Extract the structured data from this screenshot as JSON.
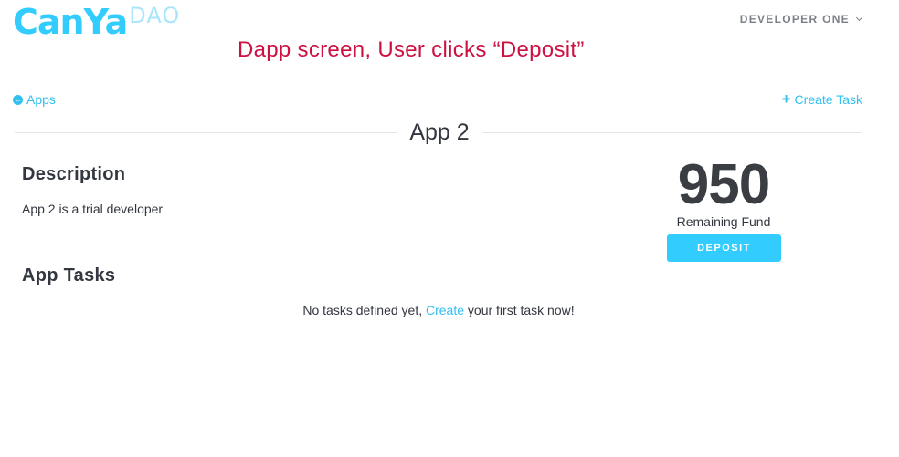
{
  "header": {
    "logo_main": "CanYa",
    "logo_suffix": "DAO",
    "user_name": "DEVELOPER ONE"
  },
  "annotation": "Dapp screen, User clicks “Deposit”",
  "nav": {
    "back_label": "Apps",
    "back_icon": "arrow-circle-left-icon",
    "create_label": "Create Task",
    "create_icon": "plus-icon"
  },
  "page": {
    "title": "App 2"
  },
  "description": {
    "heading": "Description",
    "text": "App 2 is a trial developer"
  },
  "fund": {
    "value": "950",
    "label": "Remaining Fund",
    "deposit_label": "DEPOSIT"
  },
  "tasks": {
    "heading": "App Tasks",
    "empty_before": "No tasks defined yet, ",
    "empty_link": "Create",
    "empty_after": " your first task now!"
  },
  "colors": {
    "accent": "#33ccff",
    "link": "#33c0ef",
    "annotation": "#cc1141",
    "text": "#333740"
  }
}
